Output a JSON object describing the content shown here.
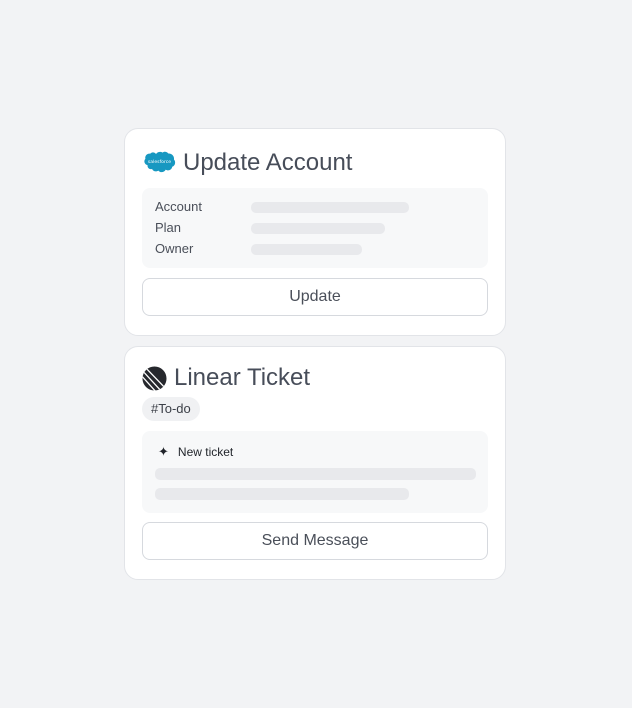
{
  "salesforce_card": {
    "title": "Update Account",
    "logo_text": "salesforce",
    "icon": "salesforce-cloud-icon",
    "fields": [
      {
        "label": "Account"
      },
      {
        "label": "Plan"
      },
      {
        "label": "Owner"
      }
    ],
    "button_label": "Update"
  },
  "linear_card": {
    "title": "Linear Ticket",
    "icon": "linear-logo-icon",
    "tag": "#To-do",
    "new_ticket_icon": "plus-sparkle-icon",
    "new_ticket_label": "New ticket",
    "button_label": "Send Message"
  },
  "colors": {
    "background": "#f2f3f5",
    "card": "#ffffff",
    "salesforce_blue": "#1798c1",
    "text": "#474d59",
    "skeleton": "#e8e9ec"
  }
}
